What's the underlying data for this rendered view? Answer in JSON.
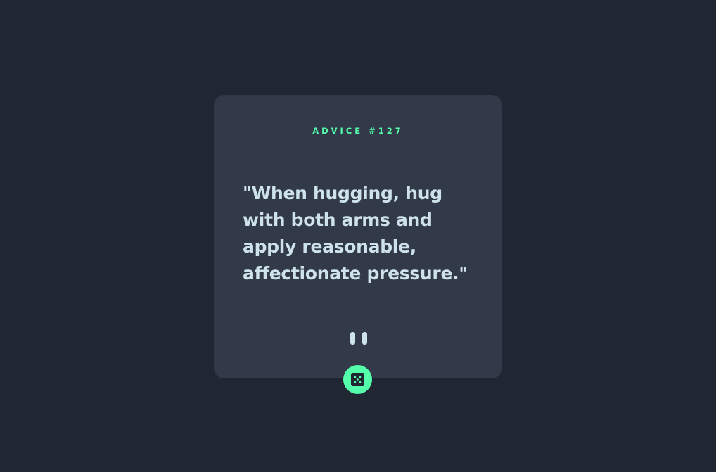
{
  "card": {
    "advice_id": "ADVICE #127",
    "quote": "\"When hugging, hug with both arms and apply reasonable, affectionate pressure.\""
  },
  "divider": {
    "icon": "pause-icon"
  },
  "button": {
    "icon": "dice-icon",
    "accent_color": "#53FFAA"
  },
  "colors": {
    "background": "#202632",
    "card": "#323A49",
    "accent": "#53FFAA",
    "text": "#CEE3E9",
    "divider": "#4F5D74"
  }
}
